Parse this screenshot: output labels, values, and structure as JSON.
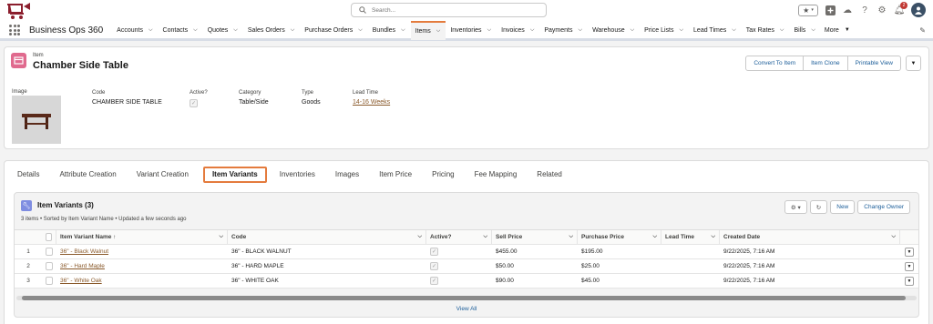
{
  "search": {
    "placeholder": "Search..."
  },
  "nav": {
    "app_name": "Business Ops 360",
    "items": [
      {
        "label": "Accounts"
      },
      {
        "label": "Contacts"
      },
      {
        "label": "Quotes"
      },
      {
        "label": "Sales Orders"
      },
      {
        "label": "Purchase Orders"
      },
      {
        "label": "Bundles"
      },
      {
        "label": "Items"
      },
      {
        "label": "Inventories"
      },
      {
        "label": "Invoices"
      },
      {
        "label": "Payments"
      },
      {
        "label": "Warehouse"
      },
      {
        "label": "Price Lists"
      },
      {
        "label": "Lead Times"
      },
      {
        "label": "Tax Rates"
      },
      {
        "label": "Bills"
      }
    ],
    "more": "More",
    "active": "Items"
  },
  "notifications": {
    "count": "2"
  },
  "record": {
    "type": "Item",
    "title": "Chamber Side Table",
    "buttons": {
      "convert": "Convert To Item",
      "clone": "Item Clone",
      "print": "Printable View"
    },
    "fields": {
      "image_label": "Image",
      "code_label": "Code",
      "code_value": "CHAMBER SIDE TABLE",
      "active_label": "Active?",
      "category_label": "Category",
      "category_value": "Table/Side",
      "type_label": "Type",
      "type_value": "Goods",
      "lead_label": "Lead Time",
      "lead_value": "14-16 Weeks"
    }
  },
  "tabs": [
    "Details",
    "Attribute Creation",
    "Variant Creation",
    "Item Variants",
    "Inventories",
    "Images",
    "Item Price",
    "Pricing",
    "Fee Mapping",
    "Related"
  ],
  "related_list": {
    "title": "Item Variants (3)",
    "subtitle": "3 items • Sorted by Item Variant Name • Updated a few seconds ago",
    "buttons": {
      "new": "New",
      "change_owner": "Change Owner"
    },
    "columns": [
      "Item Variant Name",
      "Code",
      "Active?",
      "Sell Price",
      "Purchase Price",
      "Lead Time",
      "Created Date"
    ],
    "sort_indicator": "↑",
    "rows": [
      {
        "num": "1",
        "name": "36\" - Black Walnut",
        "code": "36\" - BLACK WALNUT",
        "sell": "$455.00",
        "purchase": "$195.00",
        "lead": "",
        "created": "9/22/2025, 7:16 AM"
      },
      {
        "num": "2",
        "name": "36\" - Hard Maple",
        "code": "36\" - HARD MAPLE",
        "sell": "$50.00",
        "purchase": "$25.00",
        "lead": "",
        "created": "9/22/2025, 7:16 AM"
      },
      {
        "num": "3",
        "name": "36\" - White Oak",
        "code": "36\" - WHITE OAK",
        "sell": "$90.00",
        "purchase": "$45.00",
        "lead": "",
        "created": "9/22/2025, 7:16 AM"
      }
    ],
    "view_all": "View All"
  },
  "colors": {
    "accent": "#e47b3d",
    "link": "#8a5a2b",
    "brand_logo": "#8b1e2d",
    "object_icon": "#e06a8e"
  }
}
